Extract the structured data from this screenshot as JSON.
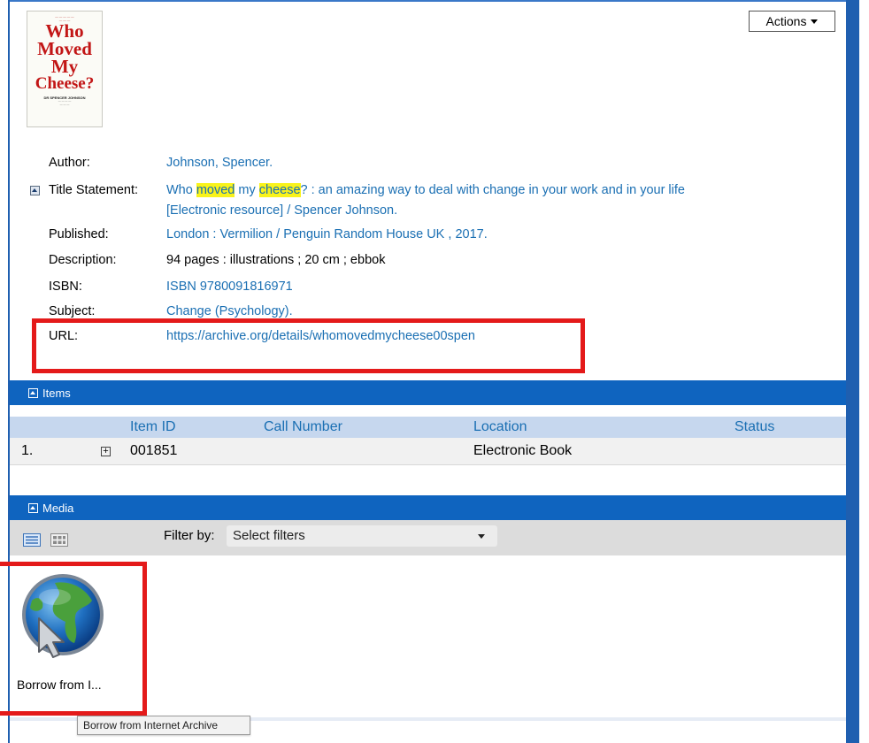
{
  "cover": {
    "title_words": [
      "Who",
      "Moved",
      "My",
      "Cheese?"
    ],
    "author": "DR SPENCER JOHNSON"
  },
  "actions_label": "Actions",
  "record": {
    "author_label": "Author:",
    "author_value": "Johnson, Spencer.",
    "title_label": "Title Statement:",
    "title_parts": [
      "Who ",
      "moved",
      " my ",
      "cheese",
      "? : an amazing way to deal with change in your work and in your life"
    ],
    "title_line2": "[Electronic resource] / Spencer Johnson.",
    "published_label": "Published:",
    "published_value": "London : Vermilion / Penguin Random House UK , 2017.",
    "description_label": "Description:",
    "description_value": "94 pages : illustrations ; 20 cm ; ebbok",
    "isbn_label": "ISBN:",
    "isbn_value": "ISBN 9780091816971",
    "subject_label": "Subject:",
    "subject_value": "Change (Psychology).",
    "url_label": "URL:",
    "url_value": "https://archive.org/details/whomovedmycheese00spen"
  },
  "items": {
    "title": "Items",
    "columns": [
      "Item ID",
      "Call Number",
      "Location",
      "Status"
    ],
    "row": {
      "num": "1.",
      "item_id": "001851",
      "call_number": "",
      "location": "Electronic Book",
      "status": ""
    }
  },
  "media": {
    "title": "Media",
    "filter_label": "Filter by:",
    "filter_value": "Select filters",
    "tile_label": "Borrow from I...",
    "tooltip": "Borrow from Internet Archive"
  },
  "colors": {
    "accent": "#0f64bf",
    "link": "#1a6fb3",
    "highlight": "#f9f31b",
    "annotation": "#e41a1a"
  }
}
